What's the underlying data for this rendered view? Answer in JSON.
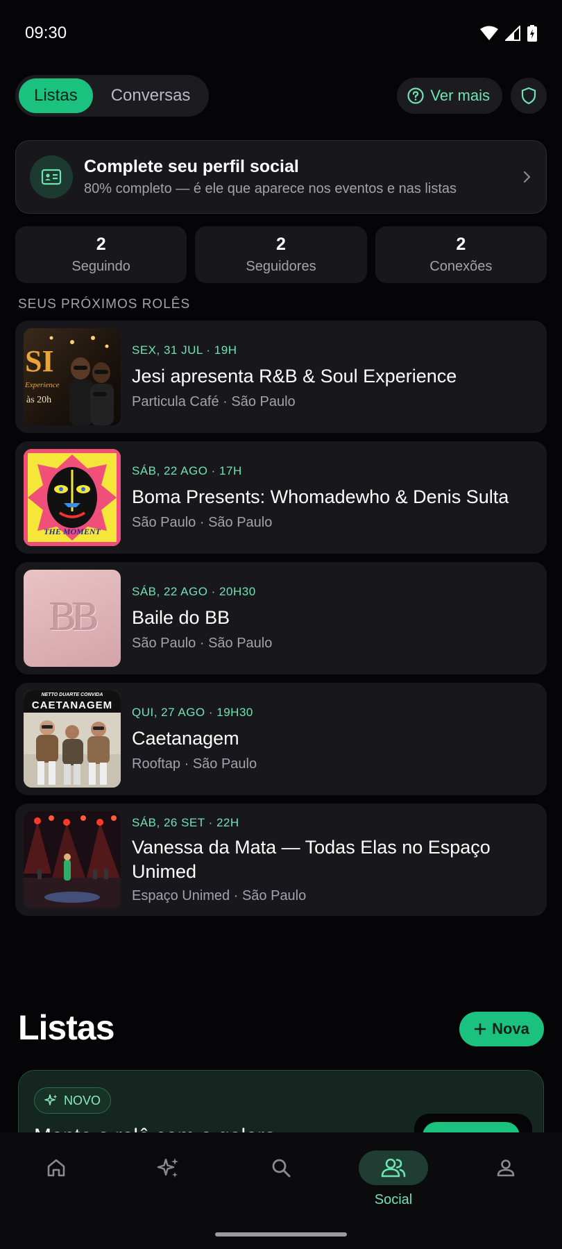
{
  "status_bar": {
    "time": "09:30"
  },
  "tabs": [
    {
      "label": "Listas",
      "active": true
    },
    {
      "label": "Conversas",
      "active": false
    }
  ],
  "top_actions": {
    "ver_mais": "Ver mais"
  },
  "profile_card": {
    "title": "Complete seu perfil social",
    "subtitle": "80% completo — é ele que aparece nos eventos e nas listas"
  },
  "stats": [
    {
      "value": "2",
      "label": "Seguindo"
    },
    {
      "value": "2",
      "label": "Seguidores"
    },
    {
      "value": "2",
      "label": "Conexões"
    }
  ],
  "section_label": "SEUS PRÓXIMOS ROLÊS",
  "events": [
    {
      "date": "SEX, 31 JUL · 19H",
      "title": "Jesi apresenta R&B & Soul Experience",
      "place": "Particula Café · São Paulo",
      "poster_text": "SI",
      "poster_sub": "Experience",
      "poster_time": "às 20h"
    },
    {
      "date": "SÁB, 22 AGO · 17H",
      "title": "Boma Presents: Whomadewho & Denis Sulta",
      "place": "São Paulo · São Paulo",
      "poster_text": "THE MOMENT"
    },
    {
      "date": "SÁB, 22 AGO · 20H30",
      "title": "Baile do BB",
      "place": "São Paulo · São Paulo",
      "poster_text": "BB"
    },
    {
      "date": "QUI, 27 AGO · 19H30",
      "title": "Caetanagem",
      "place": "Rooftap · São Paulo",
      "poster_text": "CAETANAGEM",
      "poster_sub": "NETTO DUARTE CONVIDA"
    },
    {
      "date": "SÁB, 26 SET · 22H",
      "title": "Vanessa da Mata — Todas Elas no Espaço Unimed",
      "place": "Espaço Unimed · São Paulo"
    }
  ],
  "listas": {
    "title": "Listas",
    "new_button": "Nova",
    "promo_badge": "NOVO",
    "promo_text": "Monte o rolê com a galera"
  },
  "bottom_nav": [
    {
      "icon": "home-icon",
      "label": "",
      "active": false
    },
    {
      "icon": "sparkles-icon",
      "label": "",
      "active": false
    },
    {
      "icon": "search-icon",
      "label": "",
      "active": false
    },
    {
      "icon": "people-icon",
      "label": "Social",
      "active": true
    },
    {
      "icon": "person-icon",
      "label": "",
      "active": false
    }
  ],
  "colors": {
    "accent": "#1ac17f",
    "accent_text": "#6fe3b4",
    "background": "#050507",
    "card": "#18181c"
  }
}
